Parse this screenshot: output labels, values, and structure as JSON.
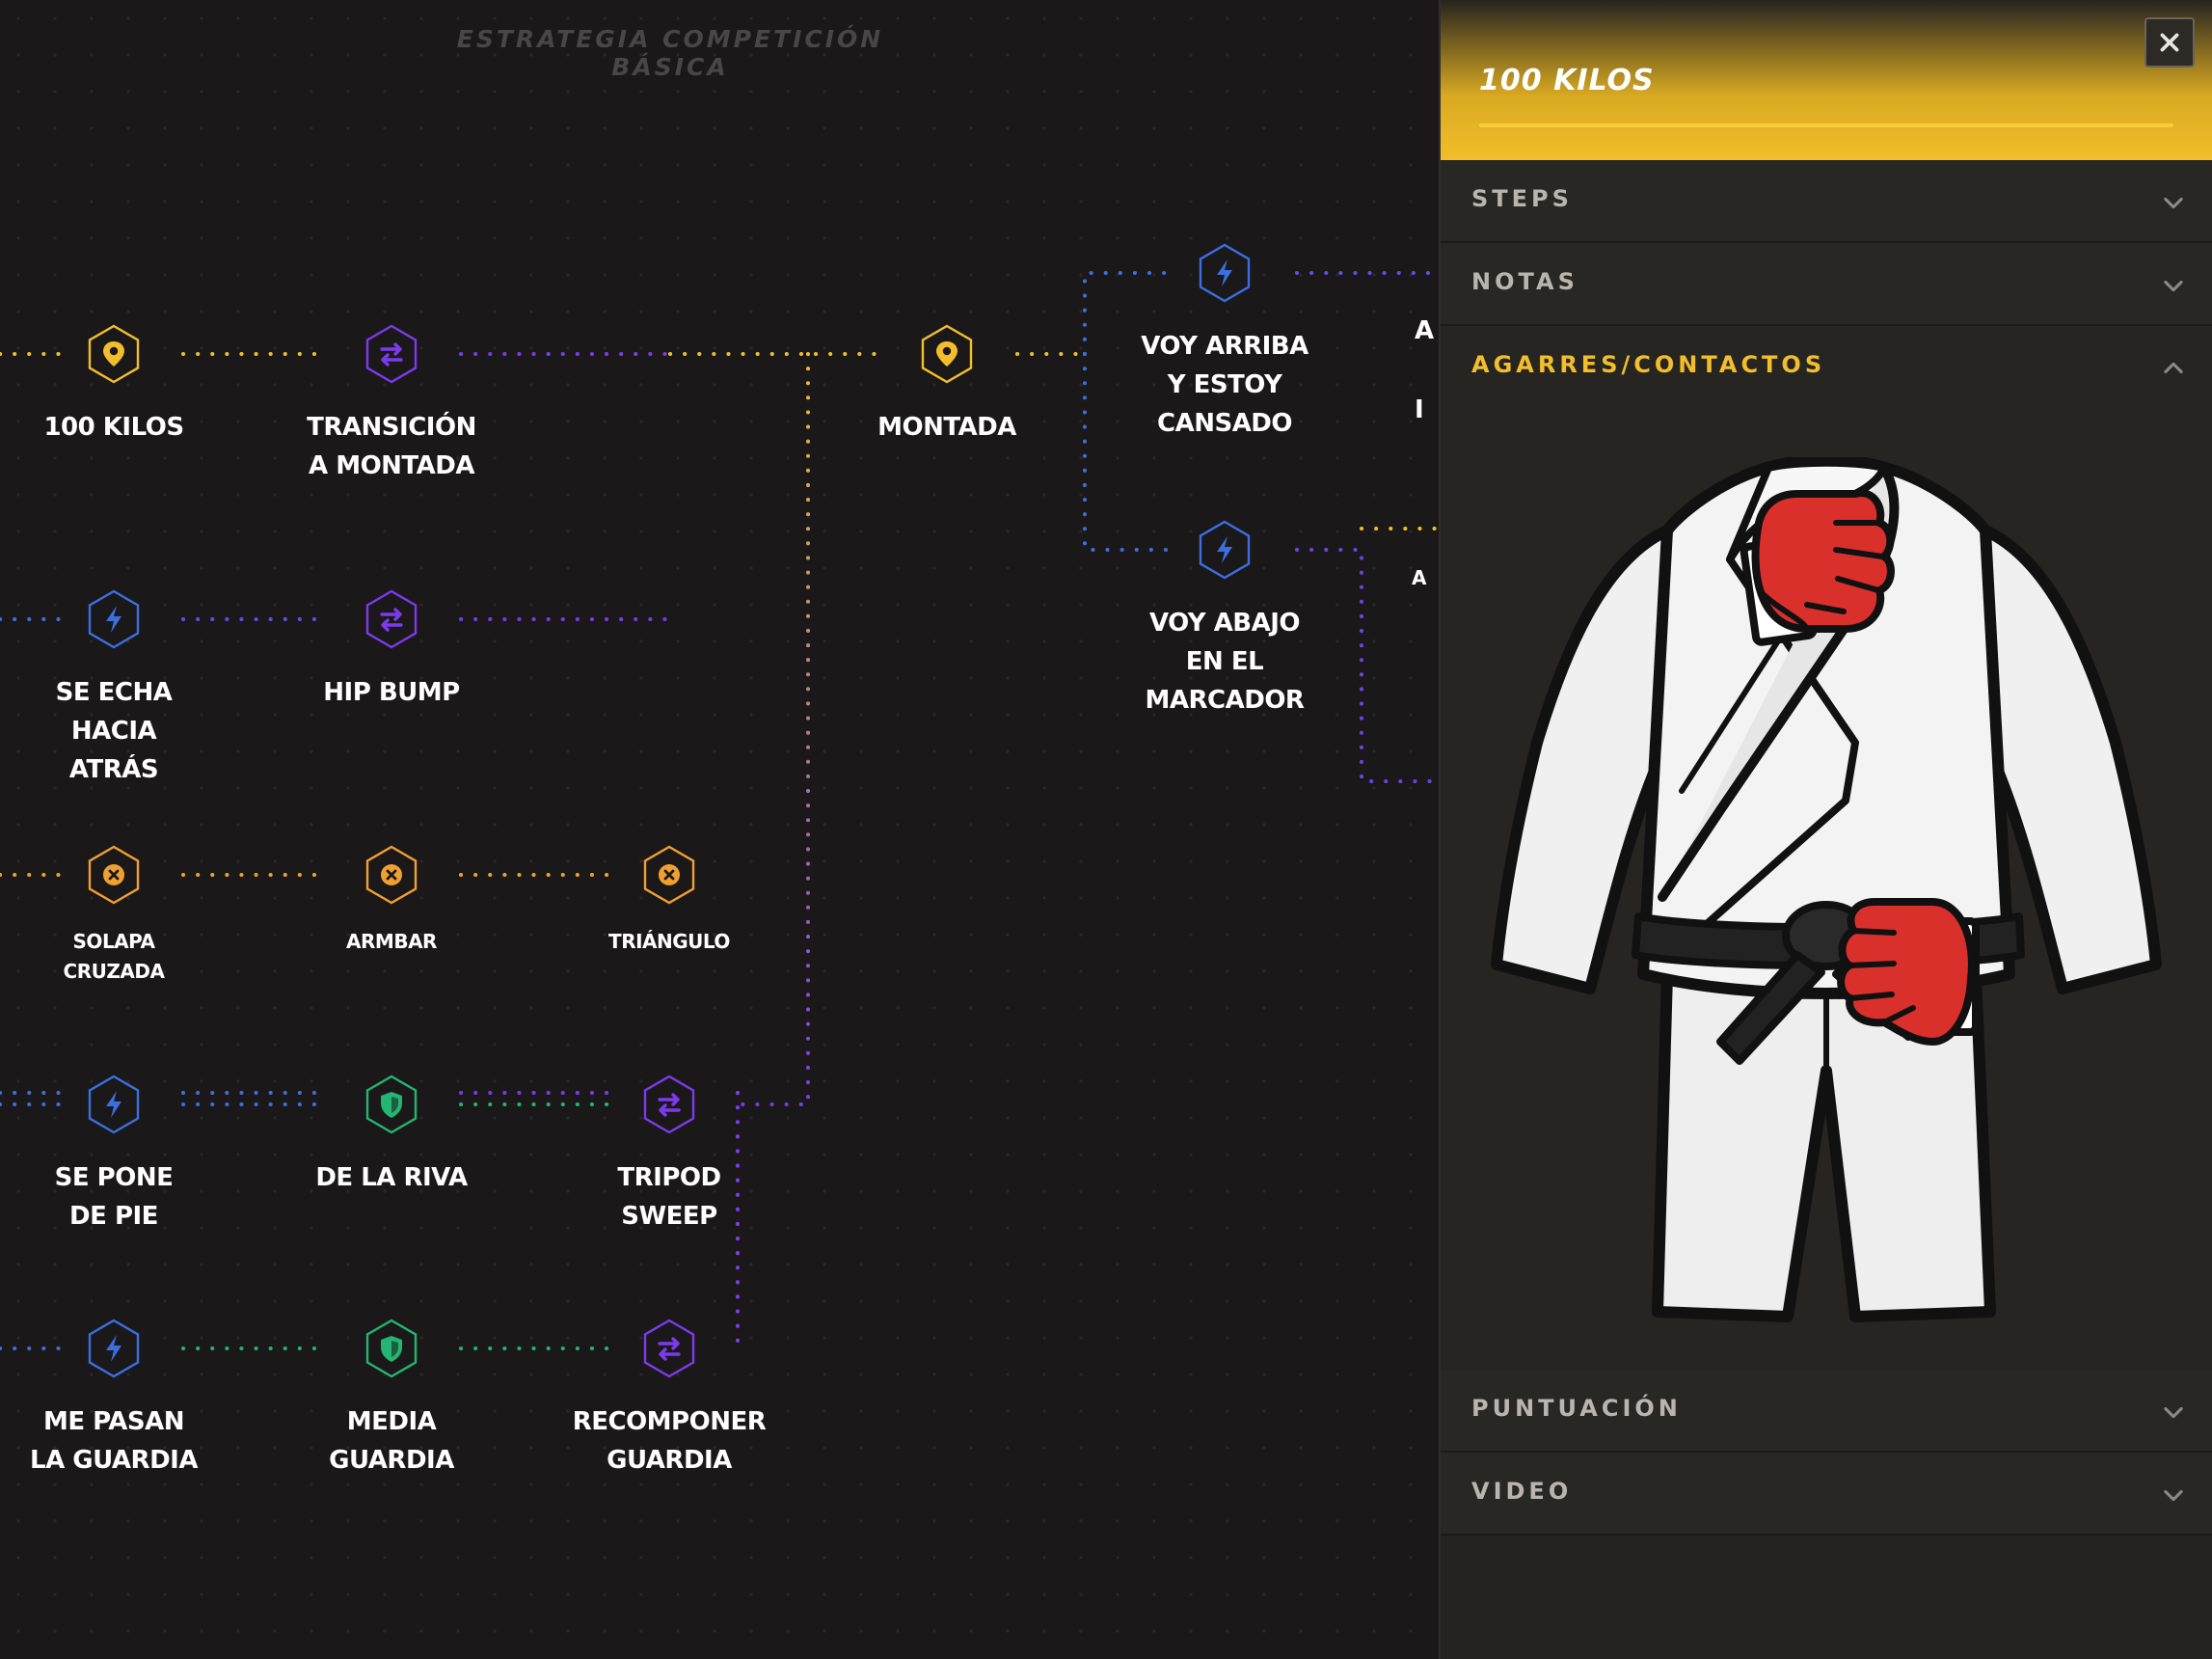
{
  "canvas": {
    "title": "ESTRATEGIA COMPETICIÓN BÁSICA"
  },
  "nodes": [
    {
      "id": "n1",
      "type": "position",
      "lines": [
        "100 KILOS"
      ],
      "size": "normal"
    },
    {
      "id": "n2",
      "type": "transition",
      "lines": [
        "TRANSICIÓN",
        "A MONTADA"
      ],
      "size": "normal"
    },
    {
      "id": "n3",
      "type": "position",
      "lines": [
        "MONTADA"
      ],
      "size": "normal"
    },
    {
      "id": "n4",
      "type": "reaction",
      "lines": [
        "VOY ARRIBA",
        "Y ESTOY",
        "CANSADO"
      ],
      "size": "normal"
    },
    {
      "id": "n5",
      "type": "reaction",
      "lines": [
        "VOY ABAJO",
        "EN EL",
        "MARCADOR"
      ],
      "size": "normal"
    },
    {
      "id": "n6",
      "type": "reaction",
      "lines": [
        "SE ECHA",
        "HACIA",
        "ATRÁS"
      ],
      "size": "normal"
    },
    {
      "id": "n7",
      "type": "transition",
      "lines": [
        "HIP BUMP"
      ],
      "size": "normal"
    },
    {
      "id": "n8",
      "type": "submission",
      "lines": [
        "SOLAPA",
        "CRUZADA"
      ],
      "size": "small"
    },
    {
      "id": "n9",
      "type": "submission",
      "lines": [
        "ARMBAR"
      ],
      "size": "small"
    },
    {
      "id": "n10",
      "type": "submission",
      "lines": [
        "TRIÁNGULO"
      ],
      "size": "small"
    },
    {
      "id": "n11",
      "type": "reaction",
      "lines": [
        "SE PONE",
        "DE PIE"
      ],
      "size": "normal"
    },
    {
      "id": "n12",
      "type": "guard",
      "lines": [
        "DE LA RIVA"
      ],
      "size": "normal"
    },
    {
      "id": "n13",
      "type": "transition",
      "lines": [
        "TRIPOD",
        "SWEEP"
      ],
      "size": "normal"
    },
    {
      "id": "n14",
      "type": "reaction",
      "lines": [
        "ME PASAN",
        "LA GUARDIA"
      ],
      "size": "normal"
    },
    {
      "id": "n15",
      "type": "guard",
      "lines": [
        "MEDIA",
        "GUARDIA"
      ],
      "size": "normal"
    },
    {
      "id": "n16",
      "type": "transition",
      "lines": [
        "RECOMPONER",
        "GUARDIA"
      ],
      "size": "normal"
    },
    {
      "id": "n17",
      "type": "partial",
      "lines": [
        "A"
      ],
      "size": "normal"
    },
    {
      "id": "n18",
      "type": "partial",
      "lines": [
        "I"
      ],
      "size": "normal"
    },
    {
      "id": "n19",
      "type": "partial",
      "lines": [
        "A"
      ],
      "size": "small"
    }
  ],
  "node_colors": {
    "position": "#f2be2b",
    "transition": "#7c3aed",
    "reaction": "#3b6fe0",
    "submission": "#f0a030",
    "guard": "#22b573"
  },
  "node_icons": {
    "position": "map-pin-icon",
    "transition": "swap-arrows-icon",
    "reaction": "lightning-icon",
    "submission": "x-circle-icon",
    "guard": "shield-icon"
  },
  "panel": {
    "title": "100 KILOS",
    "close_icon": "close-icon",
    "sections": [
      {
        "label": "STEPS",
        "expanded": false
      },
      {
        "label": "NOTAS",
        "expanded": false
      },
      {
        "label": "AGARRES/CONTACTOS",
        "expanded": true
      },
      {
        "label": "PUNTUACIÓN",
        "expanded": false
      },
      {
        "label": "VIDEO",
        "expanded": false
      }
    ],
    "accent_color": "#f2be2b",
    "grip_icon": "fist-icon",
    "diagram_icon": "gi-uniform-icon"
  }
}
